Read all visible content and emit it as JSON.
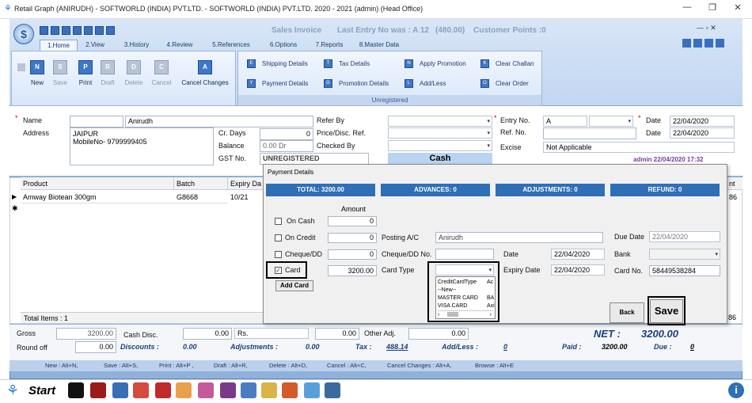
{
  "titlebar": {
    "title": "Retail Graph (ANIRUDH) - SOFTWORLD (INDIA) PVT.LTD. - SOFTWORLD (INDIA) PVT.LTD. 2020 - 2021 (admin) (Head Office)",
    "min": "—",
    "restore": "❐",
    "close": "✕"
  },
  "header": {
    "form": "Sales Invoice",
    "last_entry": "Last Entry No was : A 12",
    "amount": "(480.00)",
    "points": "Customer Points :0"
  },
  "tabs": [
    "1.Home",
    "2.View",
    "3.History",
    "4.Review",
    "5.References",
    "6.Options",
    "7.Reports",
    "8.Master Data"
  ],
  "toolbar": {
    "buttons": [
      {
        "glyph": "N",
        "label": "New",
        "enabled": true
      },
      {
        "glyph": "S",
        "label": "Save",
        "enabled": false
      },
      {
        "glyph": "P",
        "label": "Print",
        "enabled": true
      },
      {
        "glyph": "R",
        "label": "Draft",
        "enabled": false
      },
      {
        "glyph": "D",
        "label": "Delete",
        "enabled": false
      },
      {
        "glyph": "C",
        "label": "Cancel",
        "enabled": false
      },
      {
        "glyph": "A",
        "label": "Cancel Changes",
        "enabled": true
      }
    ]
  },
  "links": {
    "col1": [
      {
        "glyph": "E",
        "label": "Shipping Details"
      },
      {
        "glyph": "Y",
        "label": "Payment Details"
      }
    ],
    "col2": [
      {
        "glyph": "T",
        "label": "Tax Details"
      },
      {
        "glyph": "G",
        "label": "Promotion Details"
      }
    ],
    "col3": [
      {
        "glyph": "N",
        "label": "Apply Promotion"
      },
      {
        "glyph": "L",
        "label": "Add/Less"
      }
    ],
    "col4": [
      {
        "glyph": "K",
        "label": "Clear Challan"
      },
      {
        "glyph": "O",
        "label": "Clear Order"
      }
    ],
    "status": "Unregistered"
  },
  "form": {
    "name_label": "Name",
    "name_value": "Anirudh",
    "address_label": "Address",
    "address_line1": "JAIPUR",
    "address_line2": "MobileNo- 9799999405",
    "cr_days_label": "Cr. Days",
    "cr_days": "0",
    "balance_label": "Balance",
    "balance": "0.00 Dr",
    "gst_label": "GST No.",
    "gst": "UNREGISTERED",
    "refer_label": "Refer By",
    "price_label": "Price/Disc. Ref.",
    "checked_label": "Checked By",
    "cash": "Cash",
    "entry_label": "Entry No.",
    "entry_series": "A",
    "ref_label": "Ref. No.",
    "excise_label": "Excise",
    "excise": "Not Applicable",
    "date_label": "Date",
    "date1": "22/04/2020",
    "date2": "22/04/2020",
    "admin_stamp": "admin 22/04/2020 17:32"
  },
  "grid": {
    "headers": [
      "Product",
      "Batch",
      "Expiry Da",
      "nt"
    ],
    "rows": [
      {
        "product": "Amway Biotean 300gm",
        "batch": "G8668",
        "expiry": "10/21",
        "amount": "86"
      }
    ],
    "total_items": "Total Items : 1",
    "total_tail": "86"
  },
  "totals": {
    "gross_label": "Gross",
    "gross": "3200.00",
    "round_label": "Round off",
    "round": "0.00",
    "cashdisc_label": "Cash Disc.",
    "cashdisc": "0.00",
    "unit": "Rs.",
    "cashdisc2": "0.00",
    "otheradj_label": "Other Adj.",
    "otheradj": "0.00",
    "discounts_label": "Discounts :",
    "discounts": "0.00",
    "adjustments_label": "Adjustments :",
    "adjustments": "0.00",
    "tax_label": "Tax :",
    "tax": "488.14",
    "addless_label": "Add/Less :",
    "addless": "0",
    "net_label": "NET :",
    "net": "3200.00",
    "paid_label": "Paid :",
    "paid": "3200.00",
    "due_label": "Due :",
    "due": "0"
  },
  "shortcuts": [
    "New : Alt+N,",
    "Save : Alt+S,",
    "Print : Alt+P ,",
    "Draft : Alt+R,",
    "Delete : Alt+D,",
    "Cancel : Alt+C,",
    "Cancel Changes : Alt+A,",
    "Browse : Alt+E"
  ],
  "taskbar": {
    "start": "Start"
  },
  "dialog": {
    "title": "Payment Details",
    "total": "TOTAL: 3200.00",
    "advances": "ADVANCES: 0",
    "adjustments": "ADJUSTMENTS: 0",
    "refund": "REFUND: 0",
    "amount_header": "Amount",
    "oncash": "On Cash",
    "oncash_amt": "0",
    "oncredit": "On Credit",
    "oncredit_amt": "0",
    "cheque": "Cheque/DD",
    "cheque_amt": "0",
    "card": "Card",
    "card_amt": "3200.00",
    "add_card": "Add Card",
    "posting_label": "Posting A/C",
    "posting": "Anirudh",
    "chequeno_label": "Cheque/DD No.",
    "cardtype_label": "Card Type",
    "cardtype_options": [
      [
        "CreditCardType",
        "Ac"
      ],
      [
        "--New--",
        ""
      ],
      [
        "MASTER CARD",
        "BA"
      ],
      [
        "VISA CARD",
        "Axi"
      ]
    ],
    "date_label": "Date",
    "date": "22/04/2020",
    "expiry_label": "Expiry Date",
    "expiry": "22/04/2020",
    "duedate_label": "Due Date",
    "duedate": "22/04/2020",
    "bank_label": "Bank",
    "cardno_label": "Card No.",
    "cardno": "58449538284",
    "back": "Back",
    "save": "Save"
  }
}
